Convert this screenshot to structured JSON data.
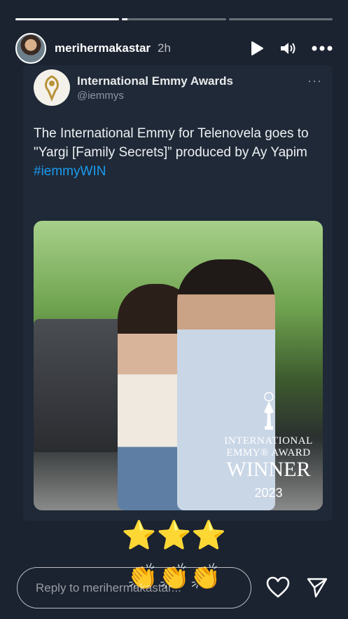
{
  "story": {
    "progress": [
      1.0,
      0.05,
      0.0,
      0.0
    ],
    "username": "merihermakastar",
    "time": "2h"
  },
  "tweet": {
    "display_name": "International Emmy Awards",
    "handle": "@iemmys",
    "more": "···",
    "text": "The International Emmy for Telenovela goes to \"Yargi [Family Secrets]” produced by Ay Yapim",
    "hashtag": "#iemmyWIN"
  },
  "award_overlay": {
    "line1": "INTERNATIONAL",
    "line2": "EMMY® AWARD",
    "line3": "WINNER",
    "year": "2023"
  },
  "stickers": {
    "stars": "⭐⭐⭐",
    "claps": "👏👏👏"
  },
  "reply": {
    "placeholder": "Reply to merihermakastar..."
  },
  "icons": [
    "play-icon",
    "volume-icon",
    "more-icon",
    "heart-icon",
    "send-icon"
  ],
  "colors": {
    "background": "#1b2230",
    "hashtag": "#1d9bf0"
  }
}
